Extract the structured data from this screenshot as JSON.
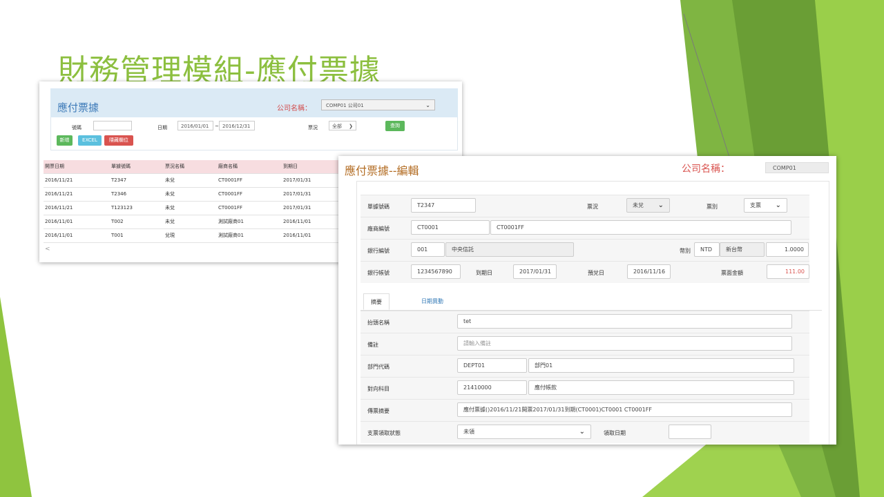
{
  "slide": {
    "title": "財務管理模組-應付票據"
  },
  "list_window": {
    "title": "應付票據",
    "company_label": "公司名稱：",
    "company_value": "COMP01 公司01",
    "filters": {
      "number_label": "號碼",
      "number_value": "",
      "date_label": "日期",
      "date_from": "2016/01/01",
      "date_sep": "~",
      "date_to": "2016/12/31",
      "status_label": "票況",
      "status_value": "全部"
    },
    "buttons": {
      "query": "查詢",
      "add": "新增",
      "excel": "EXCEL",
      "hide_cols": "隱藏欄位"
    },
    "columns": [
      "開票日期",
      "單據號碼",
      "票況名稱",
      "廠商名稱",
      "到期日"
    ],
    "rows": [
      [
        "2016/11/21",
        "T2347",
        "未兌",
        "CT0001FF",
        "2017/01/31"
      ],
      [
        "2016/11/21",
        "T2346",
        "未兌",
        "CT0001FF",
        "2017/01/31"
      ],
      [
        "2016/11/21",
        "T123123",
        "未兌",
        "CT0001FF",
        "2017/01/31"
      ],
      [
        "2016/11/01",
        "T002",
        "未兌",
        "測試廠商01",
        "2016/11/01"
      ],
      [
        "2016/11/01",
        "T001",
        "兌現",
        "測試廠商01",
        "2016/11/01"
      ]
    ],
    "scroll_left": "<"
  },
  "edit_window": {
    "title": "應付票據--編輯",
    "company_label": "公司名稱：",
    "company_value": "COMP01",
    "fields": {
      "doc_no_label": "單據號碼",
      "doc_no": "T2347",
      "status_label": "票況",
      "status": "未兌",
      "type_label": "票別",
      "type": "支票",
      "vendor_label": "廠商編號",
      "vendor_code": "CT0001",
      "vendor_name": "CT0001FF",
      "bank_code_label": "銀行編號",
      "bank_code": "001",
      "bank_name": "中央信託",
      "currency_label": "幣別",
      "currency": "NTD",
      "currency_name": "新台幣",
      "rate": "1.0000",
      "account_label": "銀行帳號",
      "account": "1234567890",
      "due_label": "到期日",
      "due": "2017/01/31",
      "expected_label": "預兌日",
      "expected": "2016/11/16",
      "amount_label": "票面金額",
      "amount": "111.00"
    },
    "tabs": [
      "摘要",
      "日期異動"
    ],
    "detail": {
      "payee_label": "抬頭名稱",
      "payee": "tet",
      "note_label": "備註",
      "note_placeholder": "請輸入備註",
      "dept_label": "部門代碼",
      "dept_code": "DEPT01",
      "dept_name": "部門01",
      "subject_label": "對向科目",
      "subject_code": "21410000",
      "subject_name": "應付帳款",
      "summary_label": "傳票摘要",
      "summary": "應付票據()2016/11/21開票2017/01/31到期(CT0001)CT0001 CT0001FF",
      "pickup_status_label": "支票領取狀態",
      "pickup_status": "未領",
      "pickup_date_label": "領取日期",
      "pickup_date": ""
    }
  },
  "colors": {
    "title_green": "#8cbf3f",
    "accent_red": "#d9534f",
    "brand_blue": "#3d7ab8",
    "edit_title": "#b36d24"
  }
}
